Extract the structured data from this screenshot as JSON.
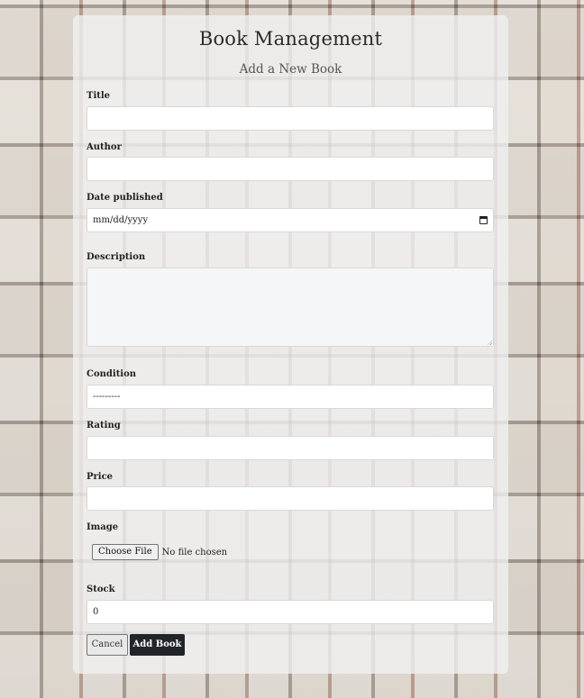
{
  "header": {
    "title": "Book Management",
    "subtitle": "Add a New Book"
  },
  "form": {
    "title_label": "Title",
    "title_value": "",
    "author_label": "Author",
    "author_value": "",
    "date_label": "Date published",
    "date_placeholder": "mm/dd/yyyy",
    "description_label": "Description",
    "description_value": "",
    "condition_label": "Condition",
    "condition_selected": "---------",
    "rating_label": "Rating",
    "rating_value": "",
    "price_label": "Price",
    "price_value": "",
    "image_label": "Image",
    "image_button": "Choose File",
    "image_status": "No file chosen",
    "stock_label": "Stock",
    "stock_value": "0"
  },
  "actions": {
    "cancel_label": "Cancel",
    "submit_label": "Add Book"
  },
  "icons": {
    "date_picker": "calendar-icon"
  },
  "colors": {
    "primary_button": "#212529",
    "panel_background": "#f0f0f0",
    "description_field": "#f5f6f8"
  }
}
